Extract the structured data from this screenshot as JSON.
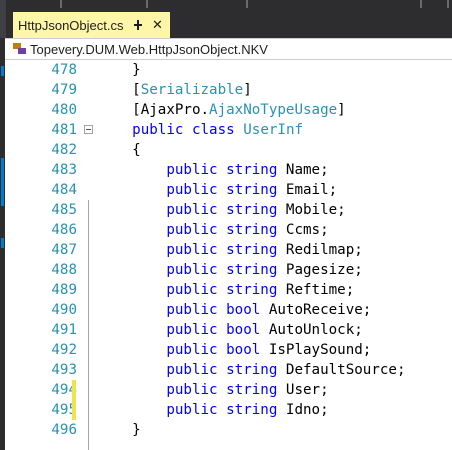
{
  "colors": {
    "chrome_dark": "#2d2d30",
    "active_tab": "#fff7a7",
    "line_number": "#2b91af",
    "keyword": "#0000ff",
    "type_name": "#2b91af",
    "plain_text": "#000000",
    "change_marker": "#efe34e"
  },
  "tab": {
    "title": "HttpJsonObject.cs",
    "pin_icon": "pin-icon",
    "close_glyph": "✕"
  },
  "navbar": {
    "icon": "class-member-icon",
    "scope": "Topevery.DUM.Web.HttpJsonObject.NKV"
  },
  "code_lines": [
    {
      "n": "478",
      "tokens": [
        {
          "t": "    }",
          "k": "p"
        }
      ]
    },
    {
      "n": "479",
      "tokens": [
        {
          "t": "    [",
          "k": "p"
        },
        {
          "t": "Serializable",
          "k": "t"
        },
        {
          "t": "]",
          "k": "p"
        }
      ]
    },
    {
      "n": "480",
      "tokens": [
        {
          "t": "    [AjaxPro.",
          "k": "p"
        },
        {
          "t": "AjaxNoTypeUsage",
          "k": "t"
        },
        {
          "t": "]",
          "k": "p"
        }
      ]
    },
    {
      "n": "481",
      "tokens": [
        {
          "t": "    ",
          "k": "p"
        },
        {
          "t": "public",
          "k": "k"
        },
        {
          "t": " ",
          "k": "p"
        },
        {
          "t": "class",
          "k": "k"
        },
        {
          "t": " ",
          "k": "p"
        },
        {
          "t": "UserInf",
          "k": "t"
        }
      ]
    },
    {
      "n": "482",
      "tokens": [
        {
          "t": "    {",
          "k": "p"
        }
      ]
    },
    {
      "n": "483",
      "tokens": [
        {
          "t": "        ",
          "k": "p"
        },
        {
          "t": "public",
          "k": "k"
        },
        {
          "t": " ",
          "k": "p"
        },
        {
          "t": "string",
          "k": "k"
        },
        {
          "t": " Name;",
          "k": "p"
        }
      ]
    },
    {
      "n": "484",
      "tokens": [
        {
          "t": "        ",
          "k": "p"
        },
        {
          "t": "public",
          "k": "k"
        },
        {
          "t": " ",
          "k": "p"
        },
        {
          "t": "string",
          "k": "k"
        },
        {
          "t": " Email;",
          "k": "p"
        }
      ]
    },
    {
      "n": "485",
      "tokens": [
        {
          "t": "        ",
          "k": "p"
        },
        {
          "t": "public",
          "k": "k"
        },
        {
          "t": " ",
          "k": "p"
        },
        {
          "t": "string",
          "k": "k"
        },
        {
          "t": " Mobile;",
          "k": "p"
        }
      ]
    },
    {
      "n": "486",
      "tokens": [
        {
          "t": "        ",
          "k": "p"
        },
        {
          "t": "public",
          "k": "k"
        },
        {
          "t": " ",
          "k": "p"
        },
        {
          "t": "string",
          "k": "k"
        },
        {
          "t": " Ccms;",
          "k": "p"
        }
      ]
    },
    {
      "n": "487",
      "tokens": [
        {
          "t": "        ",
          "k": "p"
        },
        {
          "t": "public",
          "k": "k"
        },
        {
          "t": " ",
          "k": "p"
        },
        {
          "t": "string",
          "k": "k"
        },
        {
          "t": " Redilmap;",
          "k": "p"
        }
      ]
    },
    {
      "n": "488",
      "tokens": [
        {
          "t": "        ",
          "k": "p"
        },
        {
          "t": "public",
          "k": "k"
        },
        {
          "t": " ",
          "k": "p"
        },
        {
          "t": "string",
          "k": "k"
        },
        {
          "t": " Pagesize;",
          "k": "p"
        }
      ]
    },
    {
      "n": "489",
      "tokens": [
        {
          "t": "        ",
          "k": "p"
        },
        {
          "t": "public",
          "k": "k"
        },
        {
          "t": " ",
          "k": "p"
        },
        {
          "t": "string",
          "k": "k"
        },
        {
          "t": " Reftime;",
          "k": "p"
        }
      ]
    },
    {
      "n": "490",
      "tokens": [
        {
          "t": "        ",
          "k": "p"
        },
        {
          "t": "public",
          "k": "k"
        },
        {
          "t": " ",
          "k": "p"
        },
        {
          "t": "bool",
          "k": "k"
        },
        {
          "t": " AutoReceive;",
          "k": "p"
        }
      ]
    },
    {
      "n": "491",
      "tokens": [
        {
          "t": "        ",
          "k": "p"
        },
        {
          "t": "public",
          "k": "k"
        },
        {
          "t": " ",
          "k": "p"
        },
        {
          "t": "bool",
          "k": "k"
        },
        {
          "t": " AutoUnlock;",
          "k": "p"
        }
      ]
    },
    {
      "n": "492",
      "tokens": [
        {
          "t": "        ",
          "k": "p"
        },
        {
          "t": "public",
          "k": "k"
        },
        {
          "t": " ",
          "k": "p"
        },
        {
          "t": "bool",
          "k": "k"
        },
        {
          "t": " IsPlaySound;",
          "k": "p"
        }
      ]
    },
    {
      "n": "493",
      "tokens": [
        {
          "t": "        ",
          "k": "p"
        },
        {
          "t": "public",
          "k": "k"
        },
        {
          "t": " ",
          "k": "p"
        },
        {
          "t": "string",
          "k": "k"
        },
        {
          "t": " DefaultSource;",
          "k": "p"
        }
      ]
    },
    {
      "n": "494",
      "changed": true,
      "tokens": [
        {
          "t": "        ",
          "k": "p"
        },
        {
          "t": "public",
          "k": "k"
        },
        {
          "t": " ",
          "k": "p"
        },
        {
          "t": "string",
          "k": "k"
        },
        {
          "t": " User;",
          "k": "p"
        }
      ]
    },
    {
      "n": "495",
      "changed": true,
      "tokens": [
        {
          "t": "        ",
          "k": "p"
        },
        {
          "t": "public",
          "k": "k"
        },
        {
          "t": " ",
          "k": "p"
        },
        {
          "t": "string",
          "k": "k"
        },
        {
          "t": " Idno;",
          "k": "p"
        }
      ]
    },
    {
      "n": "496",
      "tokens": [
        {
          "t": "    }",
          "k": "p"
        }
      ]
    }
  ]
}
